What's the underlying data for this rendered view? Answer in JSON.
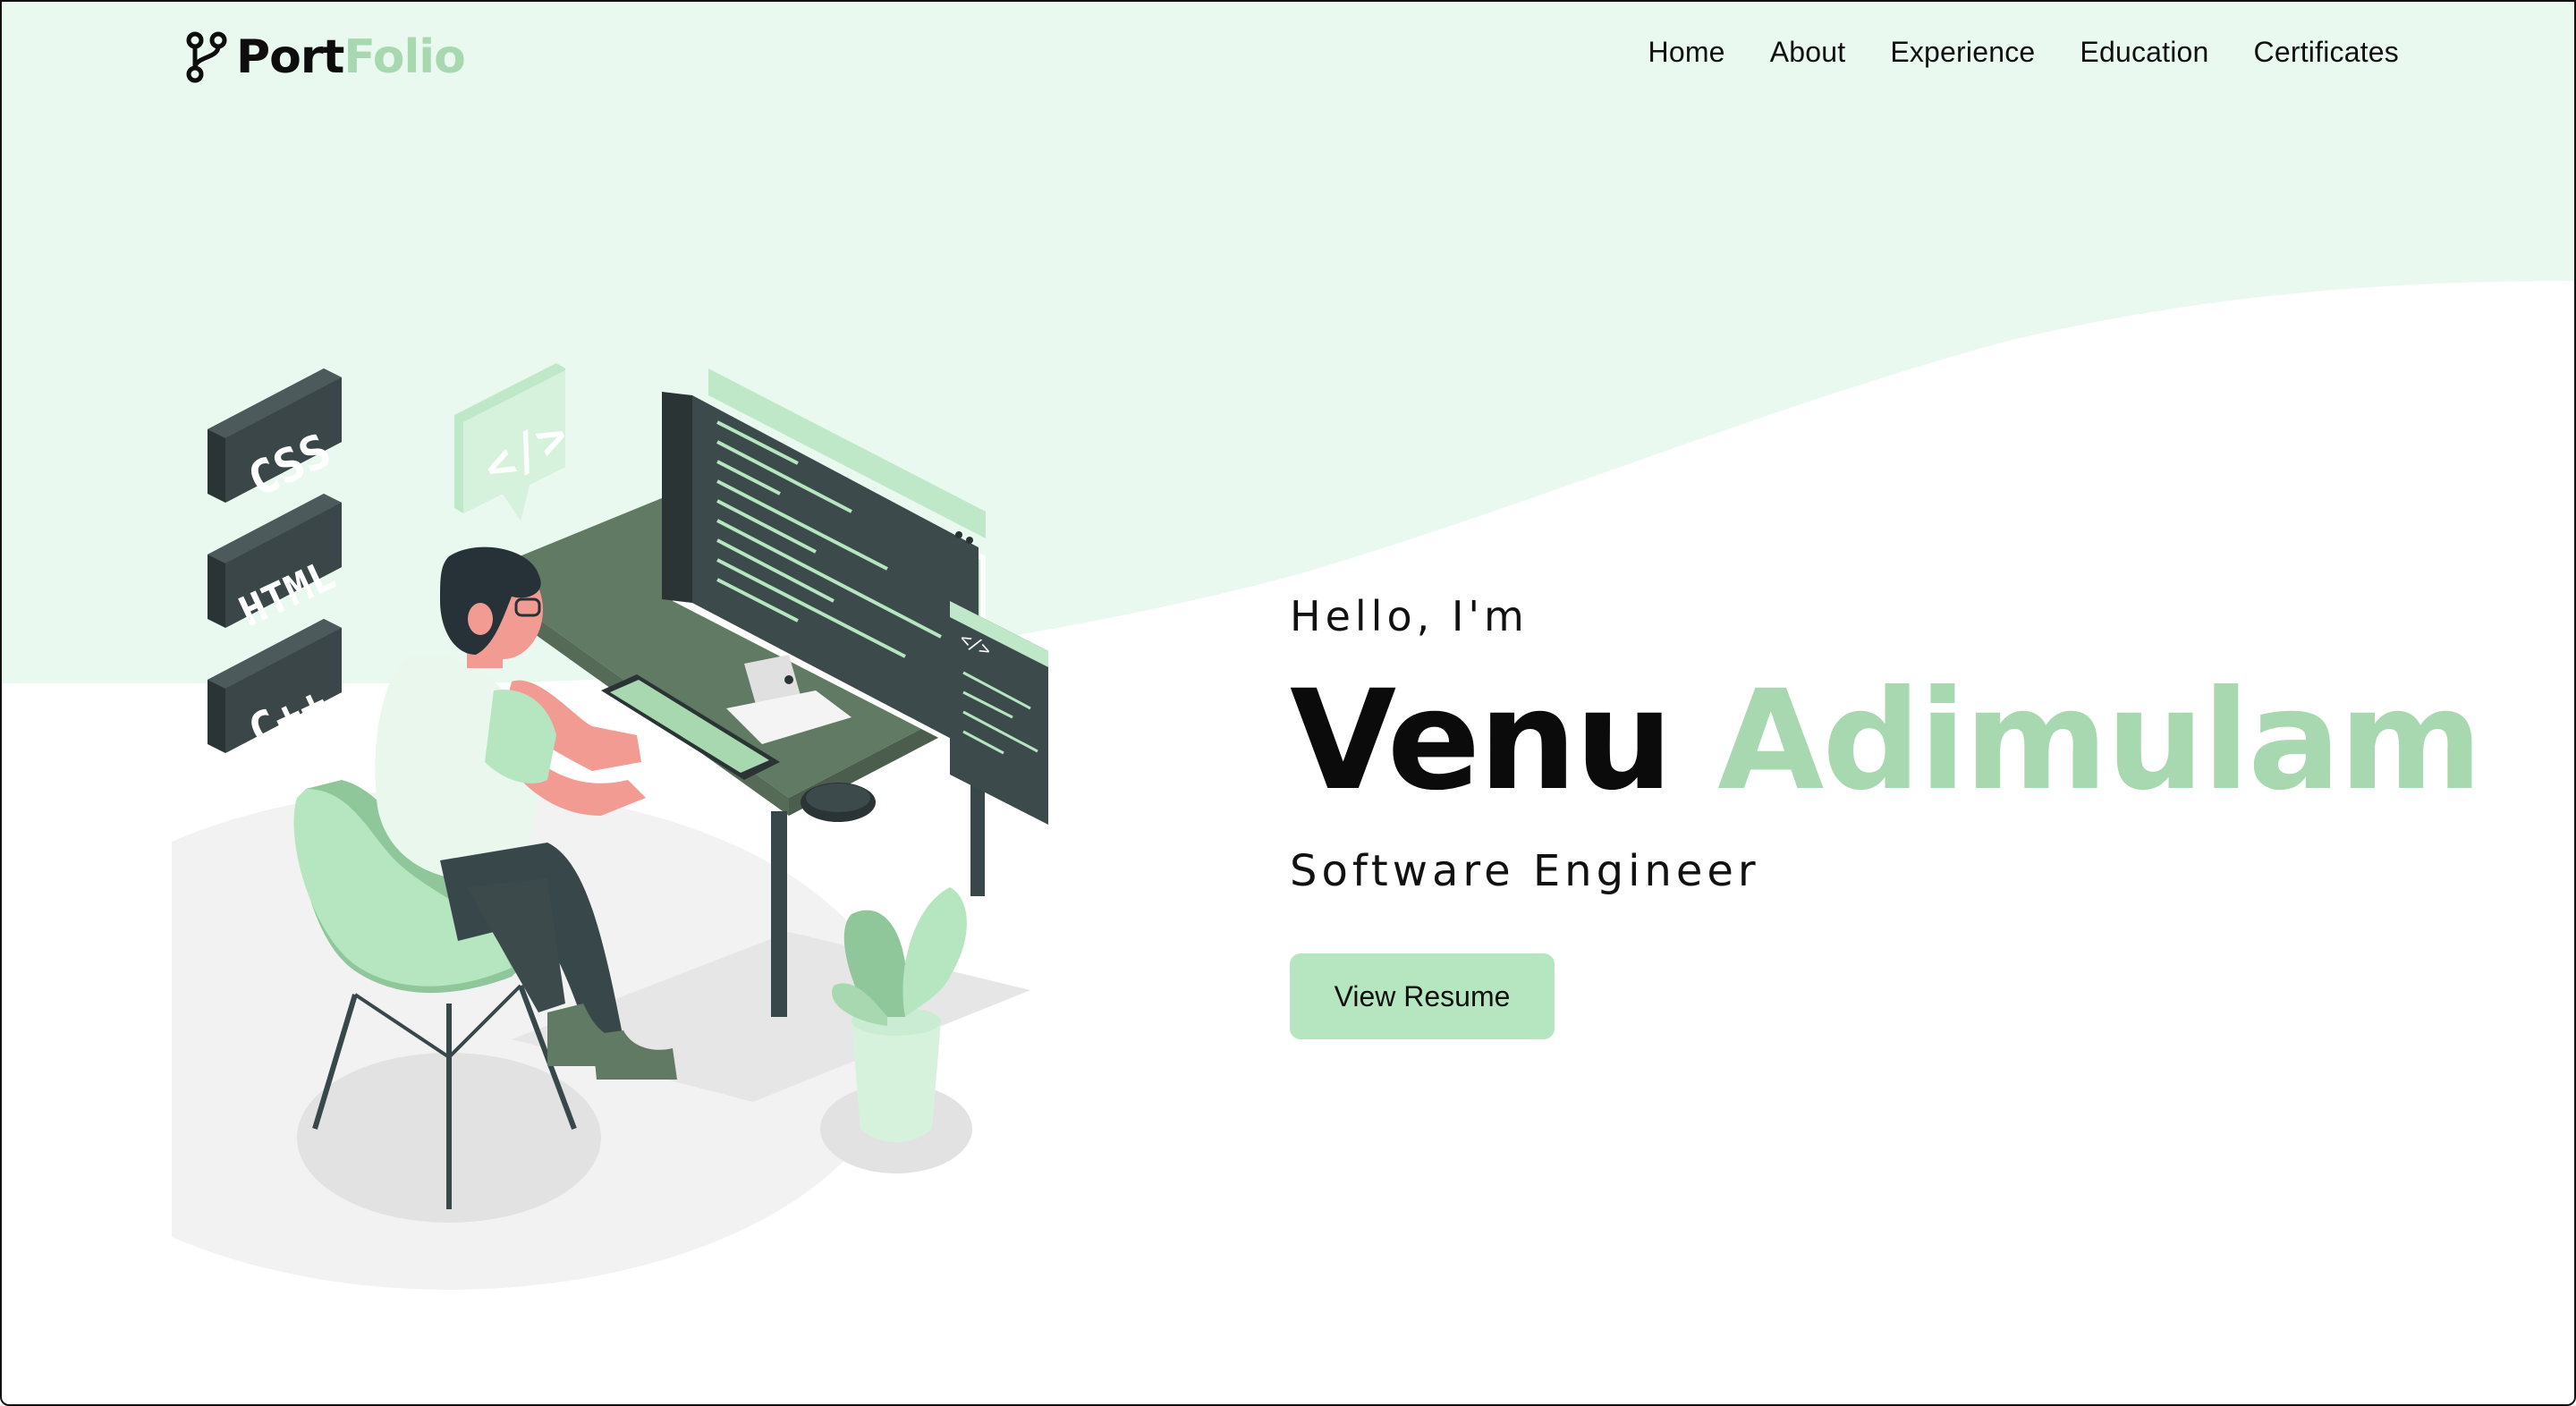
{
  "brand": {
    "part1": "Port",
    "part2": "Folio",
    "icon": "git-branch-icon"
  },
  "nav": {
    "items": [
      {
        "label": "Home"
      },
      {
        "label": "About"
      },
      {
        "label": "Experience"
      },
      {
        "label": "Education"
      },
      {
        "label": "Certificates"
      }
    ]
  },
  "hero": {
    "greeting": "Hello, I'm",
    "first_name": "Venu",
    "last_name": "Adimulam",
    "role": "Software Engineer",
    "resume_button": "View Resume"
  },
  "illustration": {
    "tags": [
      "CSS",
      "HTML",
      "C++"
    ],
    "code_bubble": "</>",
    "small_window_label": "</>"
  },
  "colors": {
    "accent": "#a8d8b0",
    "hero_background": "#eaf9ef",
    "button": "#b6e6c0",
    "text": "#0d0d0d"
  }
}
